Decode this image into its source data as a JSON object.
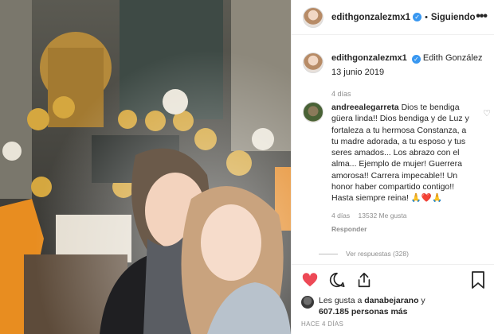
{
  "header": {
    "username": "edithgonzalezmx1",
    "verified_icon": "verified-badge-icon",
    "separator": "•",
    "follow_state": "Siguiendo",
    "more_icon": "more-options-icon",
    "more_glyph": "•••"
  },
  "caption": {
    "username": "edithgonzalezmx1",
    "text": "Edith González",
    "date": "13 junio 2019",
    "time_ago": "4 días"
  },
  "comment": {
    "username": "andreealegarreta",
    "text": "Dios te bendiga güera linda!! Dios bendiga y de Luz y fortaleza a tu hermosa Constanza, a tu madre adorada, a tu esposo y tus seres amados... Los abrazo con el alma... Ejemplo de mujer! Guerrera amorosa!! Carrera impecable!! Un honor haber compartido contigo!! Hasta siempre reina! 🙏❤️🙏",
    "time_ago": "4 días",
    "likes": "13532 Me gusta",
    "reply_label": "Responder",
    "view_replies": "Ver respuestas (328)"
  },
  "actions": {
    "like_icon": "heart-icon",
    "comment_icon": "comment-icon",
    "share_icon": "share-icon",
    "save_icon": "bookmark-icon"
  },
  "likes": {
    "prefix": "Les gusta a ",
    "user": "danabejarano",
    "middle": " y",
    "count": "607.185 personas más"
  },
  "timestamp": "HACE 4 DÍAS",
  "colors": {
    "heart_red": "#ed4956",
    "verified_blue": "#3897f0",
    "muted": "#8e8e8e"
  }
}
